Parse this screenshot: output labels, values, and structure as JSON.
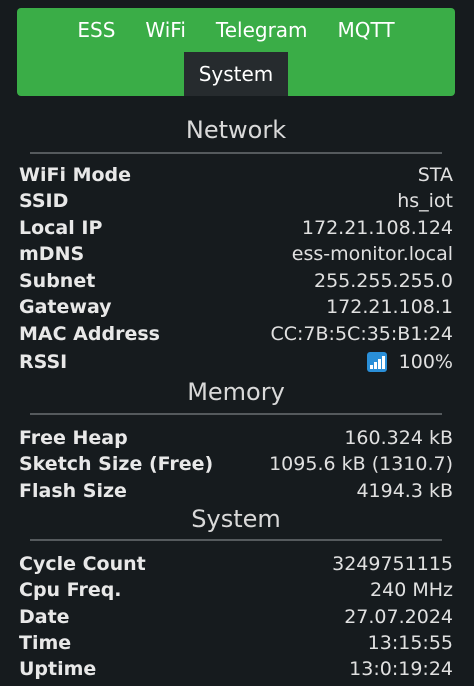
{
  "nav": {
    "tabs": [
      "ESS",
      "WiFi",
      "Telegram",
      "MQTT"
    ],
    "active_tab": "System"
  },
  "network": {
    "title": "Network",
    "rows": [
      {
        "label": "WiFi Mode",
        "value": "STA"
      },
      {
        "label": "SSID",
        "value": "hs_iot"
      },
      {
        "label": "Local IP",
        "value": "172.21.108.124"
      },
      {
        "label": "mDNS",
        "value": "ess-monitor.local"
      },
      {
        "label": "Subnet",
        "value": "255.255.255.0"
      },
      {
        "label": "Gateway",
        "value": "172.21.108.1"
      },
      {
        "label": "MAC Address",
        "value": "CC:7B:5C:35:B1:24"
      },
      {
        "label": "RSSI",
        "value": "100%",
        "icon": "signal-strength-icon"
      }
    ]
  },
  "memory": {
    "title": "Memory",
    "rows": [
      {
        "label": "Free Heap",
        "value": "160.324 kB"
      },
      {
        "label": "Sketch Size (Free)",
        "value": "1095.6 kB (1310.7)"
      },
      {
        "label": "Flash Size",
        "value": "4194.3 kB"
      }
    ]
  },
  "system": {
    "title": "System",
    "rows": [
      {
        "label": "Cycle Count",
        "value": "3249751115"
      },
      {
        "label": "Cpu Freq.",
        "value": "240 MHz"
      },
      {
        "label": "Date",
        "value": "27.07.2024"
      },
      {
        "label": "Time",
        "value": "13:15:55"
      },
      {
        "label": "Uptime",
        "value": "13:0:19:24"
      }
    ]
  },
  "colors": {
    "nav_green": "#3aad47",
    "background": "#161b1e",
    "active_tab": "#262b2e",
    "signal_icon": "#2a8fd8"
  }
}
